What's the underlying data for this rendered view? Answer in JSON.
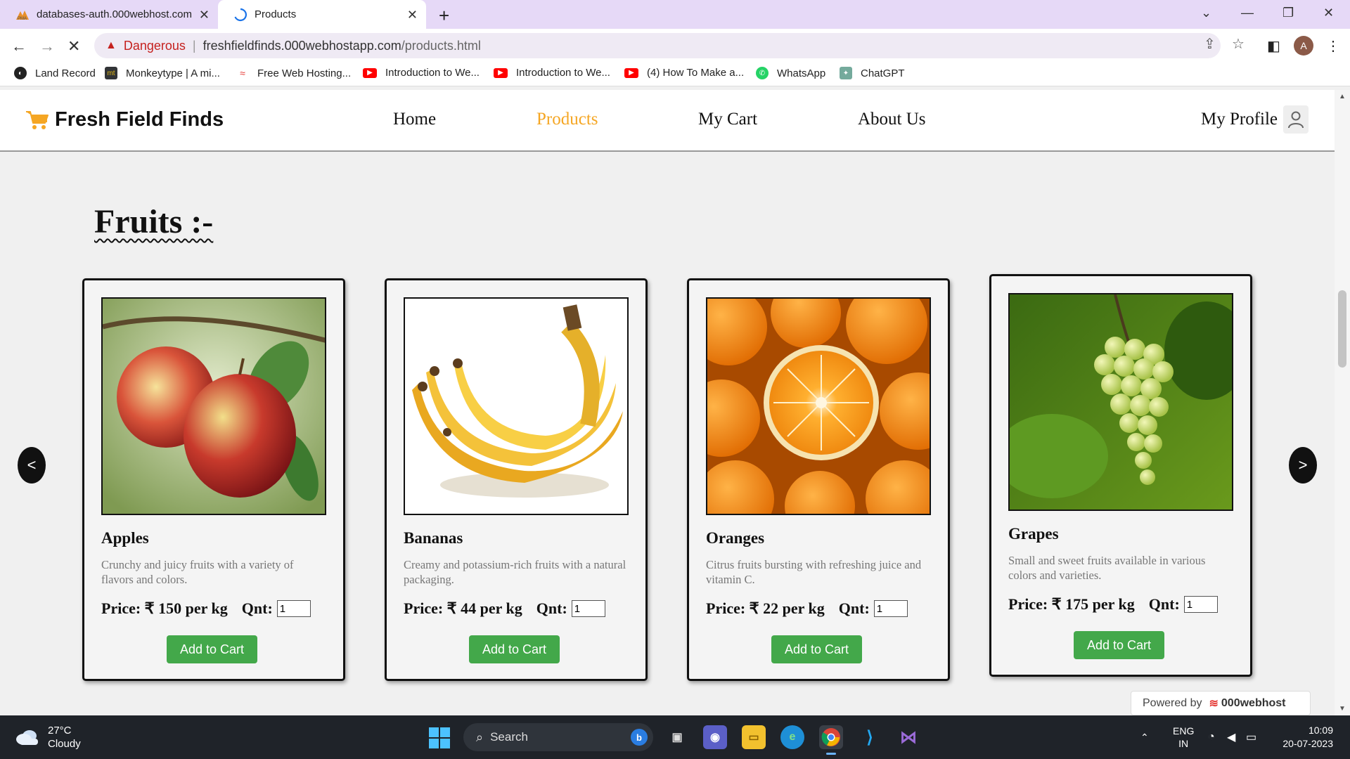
{
  "browser": {
    "tabs": [
      {
        "title": "databases-auth.000webhost.com"
      },
      {
        "title": "Products"
      }
    ],
    "security_label": "Dangerous",
    "url_host": "freshfieldfinds.000webhostapp.com",
    "url_path": "/products.html",
    "avatar_letter": "A",
    "bookmarks": [
      {
        "label": "Land Record"
      },
      {
        "label": "Monkeytype | A mi..."
      },
      {
        "label": "Free Web Hosting..."
      },
      {
        "label": "Introduction to We..."
      },
      {
        "label": "Introduction to We..."
      },
      {
        "label": "(4) How To Make a..."
      },
      {
        "label": "WhatsApp"
      },
      {
        "label": "ChatGPT"
      }
    ]
  },
  "site": {
    "brand": "Fresh Field Finds",
    "nav": [
      {
        "label": "Home"
      },
      {
        "label": "Products"
      },
      {
        "label": "My Cart"
      },
      {
        "label": "About Us"
      }
    ],
    "profile_label": "My Profile",
    "accent_color": "#f5a623",
    "button_color": "#43a84a"
  },
  "section": {
    "title": "Fruits :-",
    "prev_label": "<",
    "next_label": ">"
  },
  "products": [
    {
      "name": "Apples",
      "description": "Crunchy and juicy fruits with a variety of flavors and colors.",
      "price": "Price: ₹ 150 per kg",
      "qnt_label": "Qnt:",
      "qnt_value": "1",
      "button": "Add to Cart"
    },
    {
      "name": "Bananas",
      "description": "Creamy and potassium-rich fruits with a natural packaging.",
      "price": "Price: ₹ 44 per kg",
      "qnt_label": "Qnt:",
      "qnt_value": "1",
      "button": "Add to Cart"
    },
    {
      "name": "Oranges",
      "description": "Citrus fruits bursting with refreshing juice and vitamin C.",
      "price": "Price: ₹ 22 per kg",
      "qnt_label": "Qnt:",
      "qnt_value": "1",
      "button": "Add to Cart"
    },
    {
      "name": "Grapes",
      "description": "Small and sweet fruits available in various colors and varieties.",
      "price": "Price: ₹ 175 per kg",
      "qnt_label": "Qnt:",
      "qnt_value": "1",
      "button": "Add to Cart"
    }
  ],
  "powered": {
    "label": "Powered by",
    "brand": "000webhost"
  },
  "taskbar": {
    "temperature": "27°C",
    "weather": "Cloudy",
    "search_label": "Search",
    "language": "ENG",
    "region": "IN",
    "time": "10:09",
    "date": "20-07-2023"
  }
}
